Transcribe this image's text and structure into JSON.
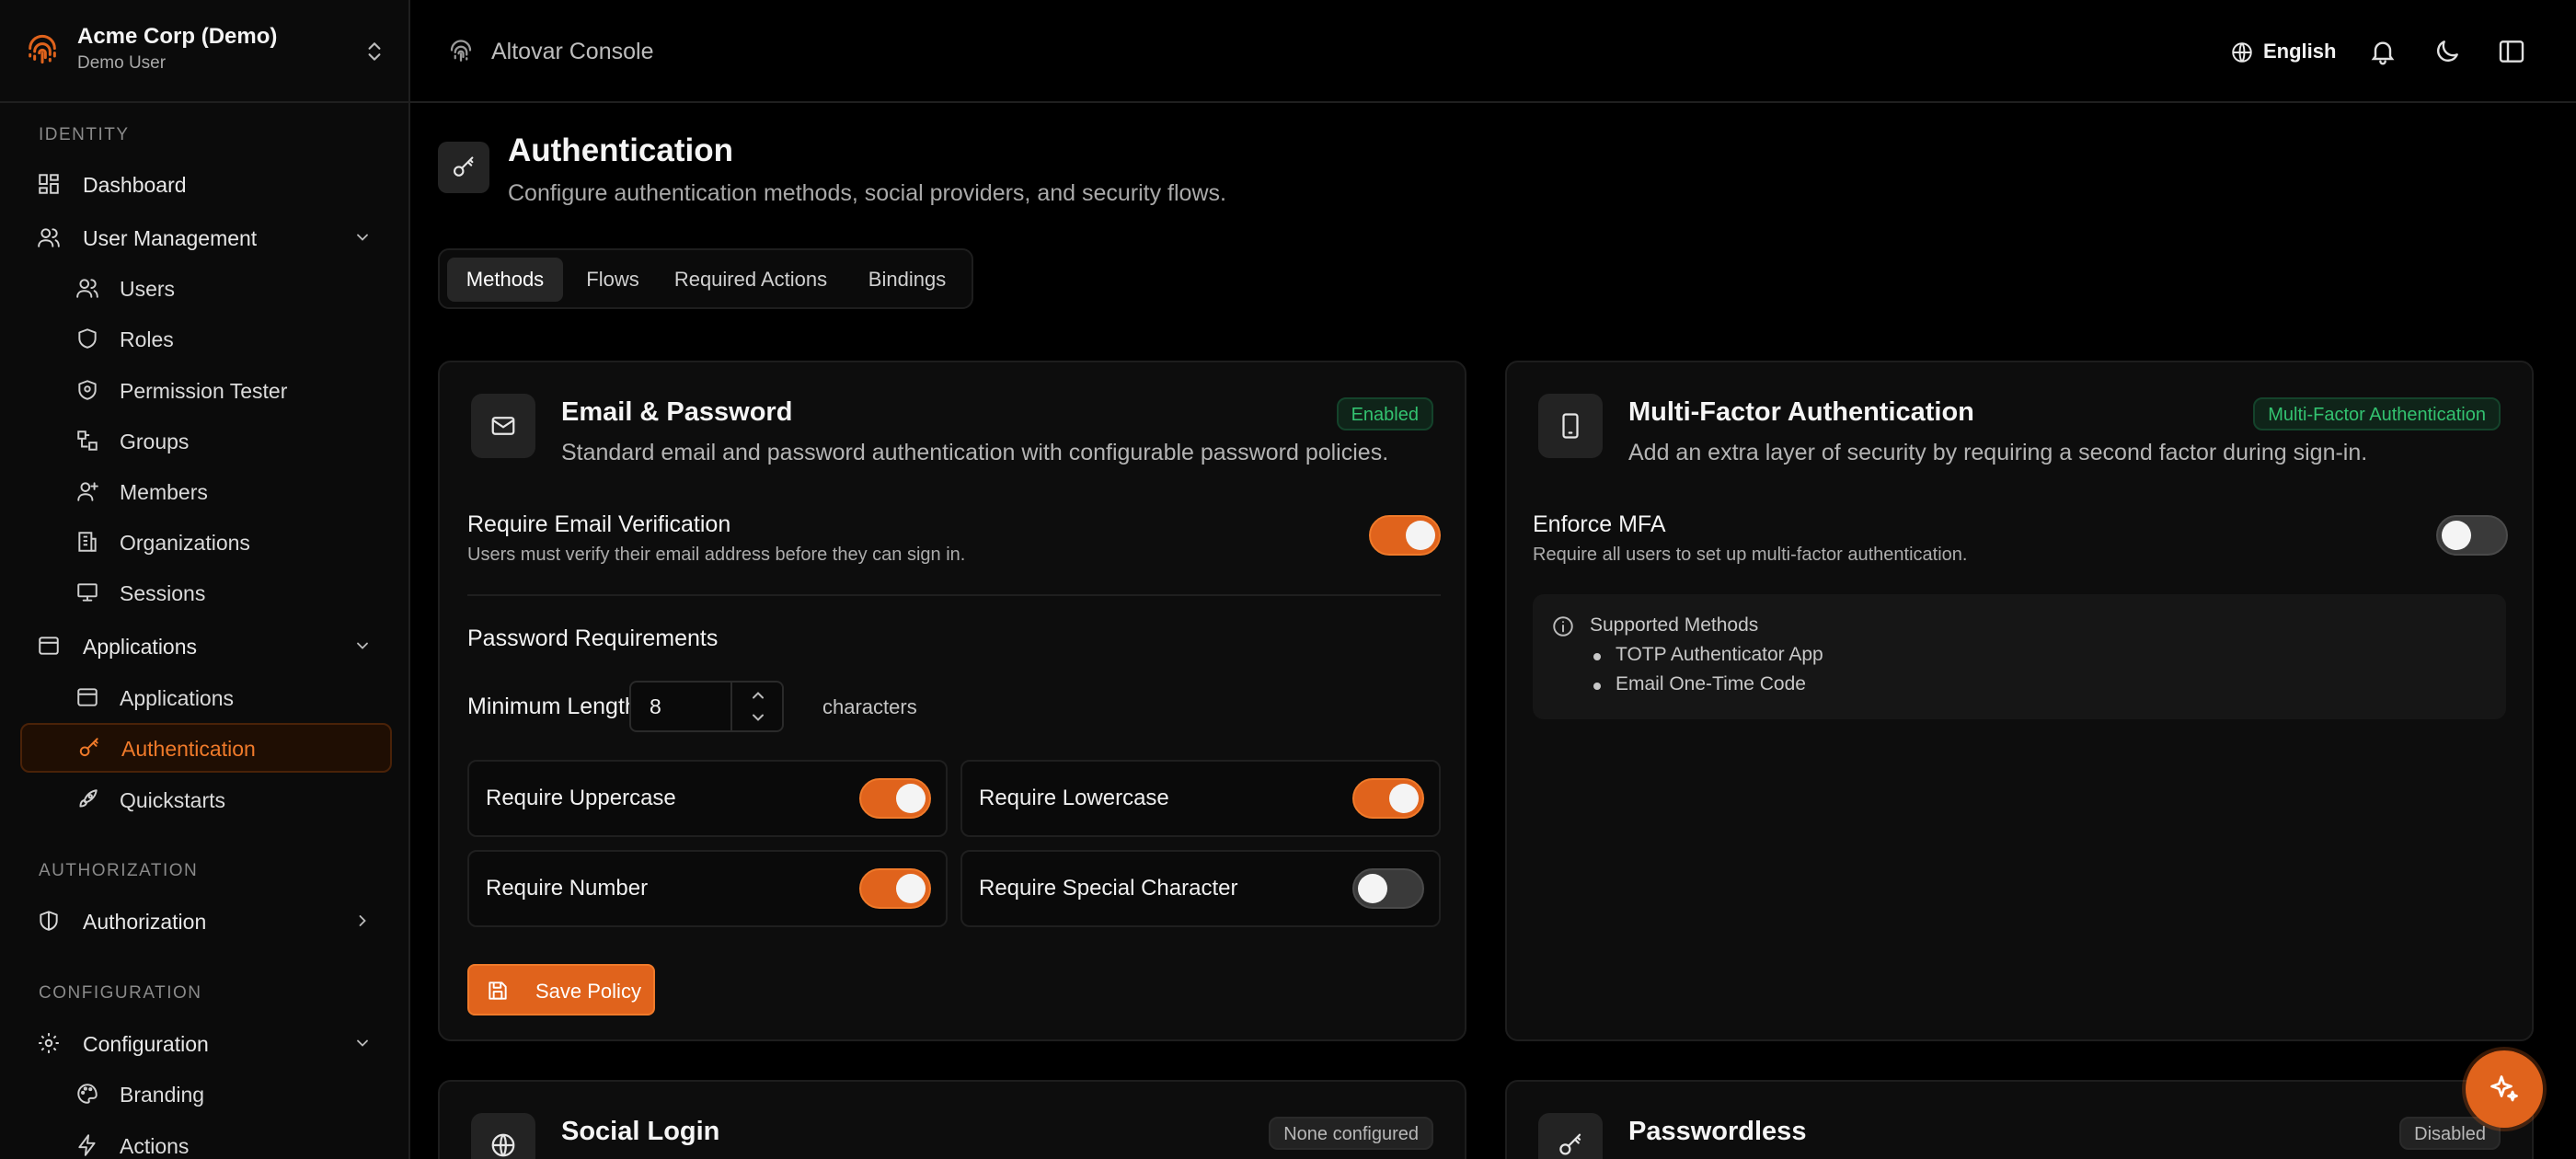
{
  "org": {
    "name": "Acme Corp (Demo)",
    "user": "Demo User"
  },
  "sidebar": {
    "sections": [
      {
        "label": "IDENTITY"
      },
      {
        "label": "AUTHORIZATION"
      },
      {
        "label": "CONFIGURATION"
      }
    ],
    "items": [
      {
        "label": "Dashboard",
        "icon": "dashboard-icon"
      },
      {
        "label": "User Management",
        "icon": "users-icon"
      },
      {
        "label": "Users",
        "icon": "users-icon"
      },
      {
        "label": "Roles",
        "icon": "shield-icon"
      },
      {
        "label": "Permission Tester",
        "icon": "shield-check-icon"
      },
      {
        "label": "Groups",
        "icon": "groups-icon"
      },
      {
        "label": "Members",
        "icon": "user-plus-icon"
      },
      {
        "label": "Organizations",
        "icon": "building-icon"
      },
      {
        "label": "Sessions",
        "icon": "monitor-icon"
      },
      {
        "label": "Applications",
        "icon": "app-window-icon"
      },
      {
        "label": "Applications",
        "icon": "app-window-icon"
      },
      {
        "label": "Authentication",
        "icon": "key-icon",
        "active": true
      },
      {
        "label": "Quickstarts",
        "icon": "rocket-icon"
      },
      {
        "label": "Authorization",
        "icon": "shield-half-icon"
      },
      {
        "label": "Configuration",
        "icon": "gear-icon"
      },
      {
        "label": "Branding",
        "icon": "palette-icon"
      },
      {
        "label": "Actions",
        "icon": "bolt-icon"
      }
    ]
  },
  "header": {
    "title": "Altovar Console",
    "language": "English"
  },
  "page": {
    "title": "Authentication",
    "subtitle": "Configure authentication methods, social providers, and security flows.",
    "tabs": [
      {
        "label": "Methods",
        "active": true
      },
      {
        "label": "Flows"
      },
      {
        "label": "Required Actions"
      },
      {
        "label": "Bindings"
      }
    ]
  },
  "email_card": {
    "title": "Email & Password",
    "description": "Standard email and password authentication with configurable password policies.",
    "badge": "Enabled",
    "verify_title": "Require Email Verification",
    "verify_desc": "Users must verify their email address before they can sign in.",
    "verify_on": true,
    "pw_heading": "Password Requirements",
    "min_length_label": "Minimum Length",
    "min_length_value": "8",
    "min_length_unit": "characters",
    "requirements": [
      {
        "label": "Require Uppercase",
        "on": true
      },
      {
        "label": "Require Lowercase",
        "on": true
      },
      {
        "label": "Require Number",
        "on": true
      },
      {
        "label": "Require Special Character",
        "on": false
      }
    ],
    "save_label": "Save Policy"
  },
  "mfa_card": {
    "title": "Multi-Factor Authentication",
    "description": "Add an extra layer of security by requiring a second factor during sign-in.",
    "badge": "Multi-Factor Authentication",
    "enforce_title": "Enforce MFA",
    "enforce_desc": "Require all users to set up multi-factor authentication.",
    "enforce_on": false,
    "supported_heading": "Supported Methods",
    "methods": [
      "TOTP Authenticator App",
      "Email One-Time Code"
    ]
  },
  "social_card": {
    "title": "Social Login",
    "badge": "None configured"
  },
  "passwordless_card": {
    "title": "Passwordless",
    "badge": "Disabled"
  },
  "colors": {
    "accent": "#e0631c",
    "accent_text": "#f07a2a",
    "success": "#33c270",
    "background": "#000000"
  }
}
